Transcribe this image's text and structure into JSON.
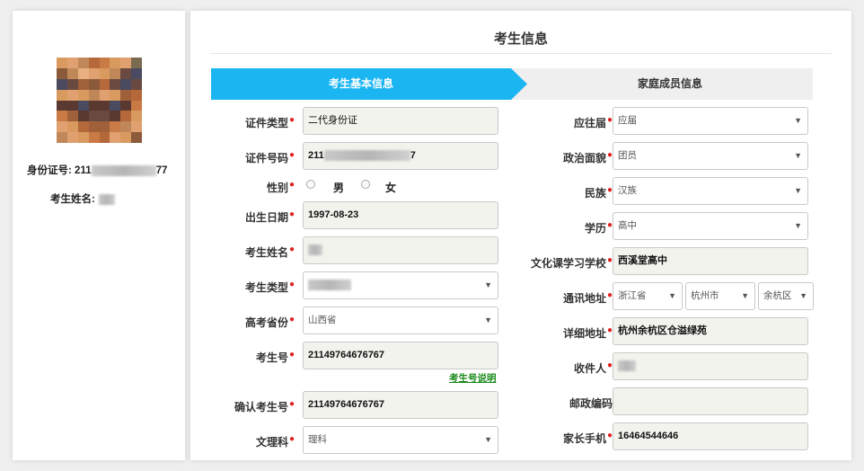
{
  "sidebar": {
    "id_label": "身份证号:",
    "id_prefix": "211",
    "id_suffix": "77",
    "name_label": "考生姓名:"
  },
  "header": {
    "title": "考生信息"
  },
  "tabs": [
    {
      "label": "考生基本信息"
    },
    {
      "label": "家庭成员信息"
    }
  ],
  "left_form": {
    "cert_type": {
      "label": "证件类型",
      "value": "二代身份证"
    },
    "cert_no": {
      "label": "证件号码",
      "value_prefix": "211",
      "value_suffix": "7"
    },
    "gender": {
      "label": "性别",
      "male": "男",
      "female": "女"
    },
    "birth": {
      "label": "出生日期",
      "value": "1997-08-23"
    },
    "name": {
      "label": "考生姓名"
    },
    "exam_type": {
      "label": "考生类型"
    },
    "province": {
      "label": "高考省份",
      "value": "山西省"
    },
    "exam_no": {
      "label": "考生号",
      "value": "21149764676767",
      "help_link": "考生号说明"
    },
    "confirm_no": {
      "label": "确认考生号",
      "value": "21149764676767"
    },
    "subject": {
      "label": "文理科",
      "value": "理科"
    }
  },
  "right_form": {
    "grad_year": {
      "label": "应往届",
      "value": "应届"
    },
    "political": {
      "label": "政治面貌",
      "value": "团员"
    },
    "ethnic": {
      "label": "民族",
      "value": "汉族"
    },
    "education": {
      "label": "学历",
      "value": "高中"
    },
    "school": {
      "label": "文化课学习学校",
      "value": "西溪堂高中"
    },
    "address": {
      "label": "通讯地址",
      "province": "浙江省",
      "city": "杭州市",
      "district": "余杭区"
    },
    "detail_address": {
      "label": "详细地址",
      "value": "杭州余杭区仓溢绿苑"
    },
    "recipient": {
      "label": "收件人"
    },
    "postcode": {
      "label": "邮政编码",
      "value": ""
    },
    "parent_phone": {
      "label": "家长手机",
      "value": "16464544646"
    }
  },
  "colors": {
    "accent": "#1bb6f2",
    "required": "#e02020",
    "link": "#1a8a1a"
  },
  "icons": {
    "chevron": "chevron-down-icon"
  }
}
